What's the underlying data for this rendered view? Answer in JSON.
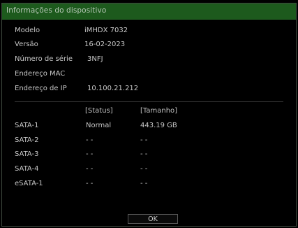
{
  "window": {
    "title": "Informações do dispositivo"
  },
  "device_info": [
    {
      "label": "Modelo",
      "value": "iMHDX 7032"
    },
    {
      "label": "Versão",
      "value": "16-02-2023"
    },
    {
      "label": "Número de série",
      "value": "3NFJ"
    },
    {
      "label": "Endereço MAC",
      "value": ""
    },
    {
      "label": "Endereço de IP",
      "value": "10.100.21.212"
    }
  ],
  "disks": {
    "headers": {
      "status": "[Status]",
      "size": "[Tamanho]"
    },
    "rows": [
      {
        "name": "SATA-1",
        "status": "Normal",
        "size": "443.19 GB"
      },
      {
        "name": "SATA-2",
        "status": "- -",
        "size": "- -"
      },
      {
        "name": "SATA-3",
        "status": "- -",
        "size": "- -"
      },
      {
        "name": "SATA-4",
        "status": "- -",
        "size": "- -"
      },
      {
        "name": "eSATA-1",
        "status": "- -",
        "size": "- -"
      }
    ]
  },
  "buttons": {
    "ok_label": "OK"
  },
  "colors": {
    "title_bar": "#1d5a1d",
    "background": "#000000",
    "text": "#c8c8c8"
  }
}
